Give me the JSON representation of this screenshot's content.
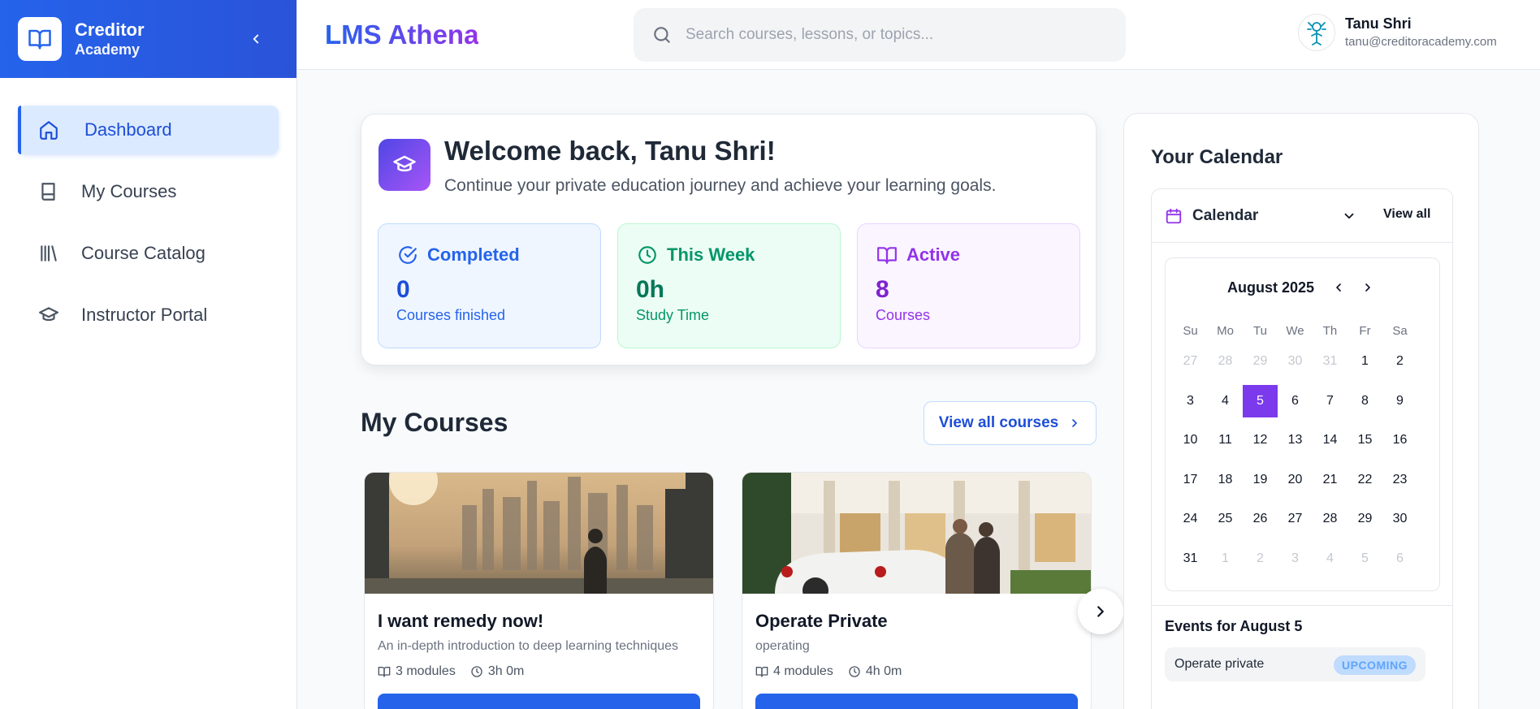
{
  "sidebar": {
    "brand_name": "Creditor",
    "brand_sub": "Academy",
    "items": [
      {
        "label": "Dashboard",
        "icon": "home-icon",
        "active": true
      },
      {
        "label": "My Courses",
        "icon": "book-icon"
      },
      {
        "label": "Course Catalog",
        "icon": "library-icon"
      },
      {
        "label": "Instructor Portal",
        "icon": "graduation-cap-icon"
      }
    ]
  },
  "header": {
    "title": "LMS Athena",
    "search_placeholder": "Search courses, lessons, or topics...",
    "user_name": "Tanu Shri",
    "user_email": "tanu@creditoracademy.com"
  },
  "welcome": {
    "title": "Welcome back, Tanu Shri!",
    "subtitle": "Continue your private education journey and achieve your learning goals.",
    "stats": [
      {
        "label": "Completed",
        "value": "0",
        "sub": "Courses finished",
        "color": "#2563eb"
      },
      {
        "label": "This Week",
        "value": "0h",
        "sub": "Study Time",
        "color": "#059669"
      },
      {
        "label": "Active",
        "value": "8",
        "sub": "Courses",
        "color": "#9333ea"
      }
    ]
  },
  "courses": {
    "title": "My Courses",
    "view_all": "View all courses",
    "items": [
      {
        "title": "I want remedy now!",
        "desc": "An in-depth introduction to deep learning techniques",
        "modules": "3 modules",
        "duration": "3h 0m"
      },
      {
        "title": "Operate Private",
        "desc": "operating",
        "modules": "4 modules",
        "duration": "4h 0m"
      }
    ]
  },
  "calendar": {
    "title": "Your Calendar",
    "dropdown_label": "Calendar",
    "view_all": "View all",
    "month": "August 2025",
    "dow": [
      "Su",
      "Mo",
      "Tu",
      "We",
      "Th",
      "Fr",
      "Sa"
    ],
    "weeks": [
      [
        "27",
        "28",
        "29",
        "30",
        "31",
        "1",
        "2"
      ],
      [
        "3",
        "4",
        "5",
        "6",
        "7",
        "8",
        "9"
      ],
      [
        "10",
        "11",
        "12",
        "13",
        "14",
        "15",
        "16"
      ],
      [
        "17",
        "18",
        "19",
        "20",
        "21",
        "22",
        "23"
      ],
      [
        "24",
        "25",
        "26",
        "27",
        "28",
        "29",
        "30"
      ],
      [
        "31",
        "1",
        "2",
        "3",
        "4",
        "5",
        "6"
      ]
    ],
    "selected_day": "5",
    "accent": "#7c3aed",
    "events_title": "Events for August 5",
    "events": [
      {
        "name": "Operate private",
        "status": "UPCOMING"
      }
    ]
  }
}
